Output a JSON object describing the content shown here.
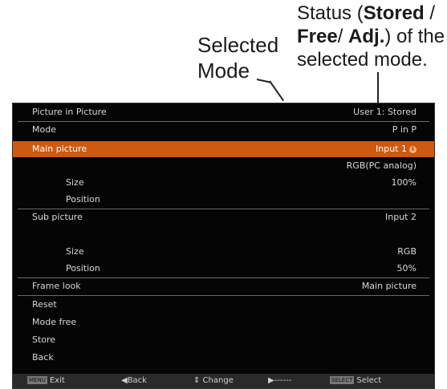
{
  "annotations": {
    "selected_mode_line1": "Selected",
    "selected_mode_line2": "Mode",
    "status_line1_prefix": "Status (",
    "status_stored": "Stored",
    "status_slash": " /",
    "status_free": "Free",
    "status_slash2": "/ ",
    "status_adj": "Adj.",
    "status_line2_suffix": ") of the",
    "status_line3": "selected mode."
  },
  "menu": {
    "header": {
      "title": "Picture in Picture",
      "status": "User 1: Stored"
    },
    "rows": {
      "mode": {
        "label": "Mode",
        "value": "P in P"
      },
      "main_picture": {
        "label": "Main picture",
        "value": "Input 1"
      },
      "main_source": {
        "value": "RGB(PC analog)"
      },
      "main_size": {
        "label": "Size",
        "value": "100%"
      },
      "main_position": {
        "label": "Position"
      },
      "sub_picture": {
        "label": "Sub picture",
        "value": "Input 2"
      },
      "sub_size": {
        "label": "Size",
        "value": "RGB"
      },
      "sub_position": {
        "label": "Position",
        "value": "50%"
      },
      "frame_look": {
        "label": "Frame look",
        "value": "Main picture"
      },
      "reset": {
        "label": "Reset"
      },
      "mode_free": {
        "label": "Mode free"
      },
      "store": {
        "label": "Store"
      },
      "back": {
        "label": "Back"
      }
    },
    "footer": {
      "menu_key": "MENU",
      "exit": "Exit",
      "back": "◀Back",
      "change": "⇕ Change",
      "next": "▶------",
      "select_key": "SELECT",
      "select": "Select"
    }
  },
  "colors": {
    "highlight": "#cc5a12",
    "osd_bg": "#050505"
  },
  "icons": [
    "up-down-spin-icon"
  ]
}
